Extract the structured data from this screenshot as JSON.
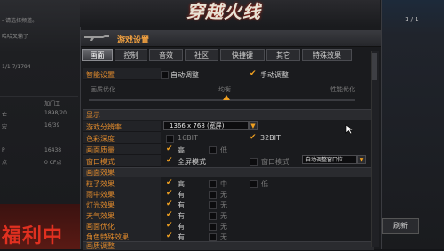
{
  "background": {
    "left_items": [
      "- 请选择频道。",
      "哈哈又输了",
      "1/1 7/1794",
      "加门工",
      "亡",
      "1898/20",
      "宏",
      "16/39",
      "P",
      "16438",
      "点",
      "0 CF点"
    ],
    "banner": "福利中",
    "refresh_label": "刷新",
    "num_badge": "1 / 1"
  },
  "dialog": {
    "logo": "穿越火线",
    "title": "游戏设置",
    "tabs": [
      "画面",
      "控制",
      "音效",
      "社区",
      "快捷键",
      "其它",
      "特殊效果"
    ],
    "active_tab": "画面",
    "quality": {
      "label": "智能设置",
      "auto_label": "自动调整",
      "manual_label": "手动调整",
      "left_label": "画质优化",
      "mid_label": "均衡",
      "right_label": "性能优化"
    },
    "display_section": "显示",
    "resolution": {
      "label": "游戏分辨率",
      "value": "1366 x 768 (宽屏)"
    },
    "color": {
      "label": "色彩深度",
      "opt1": "16BIT",
      "opt2": "32BIT"
    },
    "texture": {
      "label": "画面质量",
      "high": "高",
      "low": "低"
    },
    "window": {
      "label": "窗口模式",
      "full": "全屏模式",
      "windowed": "窗口模式",
      "select": "自动调整窗口位"
    },
    "effects_section": "画面效果",
    "effects": [
      {
        "label": "粒子效果",
        "opt1": "高",
        "opt2": "中",
        "opt3": "低"
      },
      {
        "label": "雨中效果",
        "opt1": "有",
        "opt2": "无"
      },
      {
        "label": "灯光效果",
        "opt1": "有",
        "opt2": "无"
      },
      {
        "label": "天气效果",
        "opt1": "有",
        "opt2": "无"
      },
      {
        "label": "画面优化",
        "opt1": "有",
        "opt2": "无"
      },
      {
        "label": "角色特殊效果",
        "opt1": "有",
        "opt2": "无"
      }
    ],
    "adjust_section": "画质调整"
  },
  "colors": {
    "accent": "#e08a2c",
    "check": "#f0a020",
    "logo_glow": "#b02010"
  }
}
